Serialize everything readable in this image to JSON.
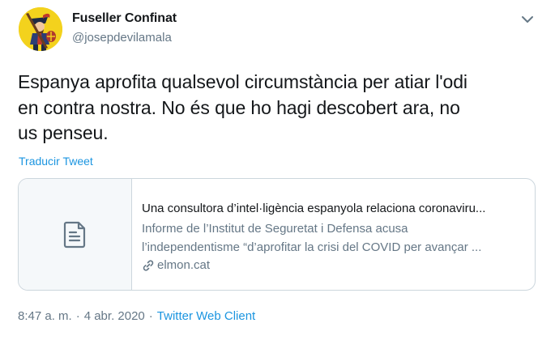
{
  "author": {
    "display_name": "Fuseller Confinat",
    "handle": "@josepdevilamala",
    "avatar_icon": "musketeer-avatar-icon"
  },
  "menu": {
    "icon": "chevron-down-icon"
  },
  "tweet": {
    "lines": [
      "Espanya aprofita qualsevol circumstància per atiar l'odi",
      "en contra nostra. No és que ho hagi descobert ara, no",
      "us penseu."
    ],
    "translate_label": "Traducir Tweet"
  },
  "card": {
    "thumbnail_icon": "document-icon",
    "title": "Una consultora d’intel·ligència espanyola relaciona coronaviru...",
    "description_lines": [
      "Informe de l’Institut de Seguretat i Defensa acusa",
      "l’independentisme “d’aprofitar la crisi del COVID per avançar ..."
    ],
    "link_icon": "link-icon",
    "domain": "elmon.cat"
  },
  "meta": {
    "time": "8:47 a. m.",
    "separator1": "·",
    "date": "4 abr. 2020",
    "separator2": "·",
    "client": "Twitter Web Client"
  },
  "colors": {
    "accent": "#1b95e0",
    "text": "#14171a",
    "muted": "#657786",
    "border": "#ccd6dd",
    "avatar_bg": "#f3d21d"
  }
}
